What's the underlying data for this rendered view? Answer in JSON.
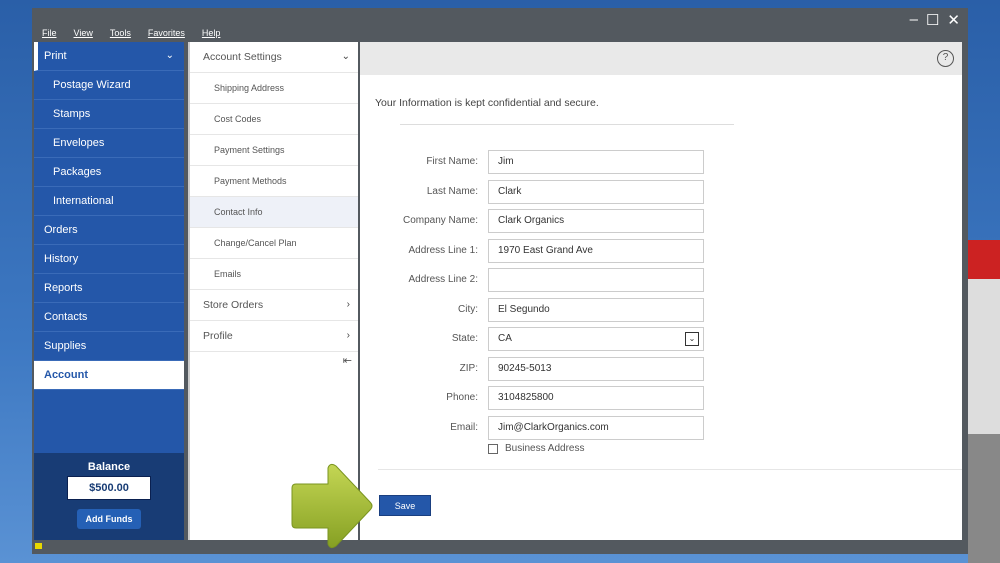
{
  "window": {
    "buttons": [
      "–",
      "☐",
      "✕"
    ]
  },
  "menu": [
    "File",
    "View",
    "Tools",
    "Favorites",
    "Help"
  ],
  "sidebar": {
    "items": [
      {
        "label": "Print",
        "sub": false
      },
      {
        "label": "Postage Wizard",
        "sub": true
      },
      {
        "label": "Stamps",
        "sub": true
      },
      {
        "label": "Envelopes",
        "sub": true
      },
      {
        "label": "Packages",
        "sub": true
      },
      {
        "label": "International",
        "sub": true
      },
      {
        "label": "Orders"
      },
      {
        "label": "History"
      },
      {
        "label": "Reports"
      },
      {
        "label": "Contacts"
      },
      {
        "label": "Supplies"
      },
      {
        "label": "Account"
      }
    ],
    "balance_label": "Balance",
    "balance": "$500.00",
    "add_funds": "Add Funds"
  },
  "subnav": {
    "header": "Account Settings",
    "items": [
      "Shipping Address",
      "Cost Codes",
      "Payment Settings",
      "Payment Methods",
      "Contact Info",
      "Change/Cancel Plan",
      "Emails"
    ],
    "store_orders": "Store Orders",
    "profile": "Profile"
  },
  "main": {
    "confidential": "Your Information is kept confidential and secure.",
    "fields": [
      {
        "label": "First Name:",
        "value": "Jim"
      },
      {
        "label": "Last Name:",
        "value": "Clark"
      },
      {
        "label": "Company Name:",
        "value": "Clark Organics"
      },
      {
        "label": "Address Line 1:",
        "value": "1970 East Grand Ave"
      },
      {
        "label": "Address Line 2:",
        "value": ""
      },
      {
        "label": "City:",
        "value": "El Segundo"
      },
      {
        "label": "State:",
        "value": "CA"
      },
      {
        "label": "ZIP:",
        "value": "90245-5013"
      },
      {
        "label": "Phone:",
        "value": "3104825800"
      },
      {
        "label": "Email:",
        "value": "Jim@ClarkOrganics.com"
      }
    ],
    "business_address": "Business Address",
    "save": "Save"
  },
  "colors": {
    "sidebar": "#2457a9",
    "accent_arrow": "#9bb52c"
  }
}
